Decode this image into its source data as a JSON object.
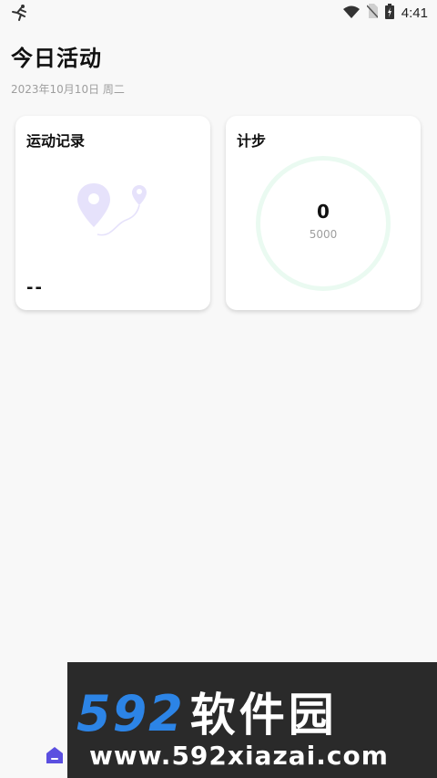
{
  "status_bar": {
    "time": "4:41",
    "left_icon": "running-figure-icon",
    "right_icons": [
      "wifi-icon",
      "no-sim-icon",
      "battery-charging-icon"
    ]
  },
  "header": {
    "title": "今日活动",
    "date": "2023年10月10日 周二"
  },
  "cards": {
    "exercise": {
      "title": "运动记录",
      "value": "--",
      "icon": "route-map-icon"
    },
    "steps": {
      "title": "计步",
      "count": "0",
      "target": "5000",
      "progress": 0
    }
  },
  "bottom_nav": {
    "home_icon": "home-icon"
  },
  "watermark": {
    "number": "592",
    "brand": "软件园",
    "url": "www.592xiazai.com"
  },
  "colors": {
    "background": "#f8f8f8",
    "card": "#ffffff",
    "ring": "#eafaf1",
    "route_icon": "#e6e2fb",
    "nav_accent": "#5b4fe0",
    "watermark_blue": "#2c84e6"
  }
}
